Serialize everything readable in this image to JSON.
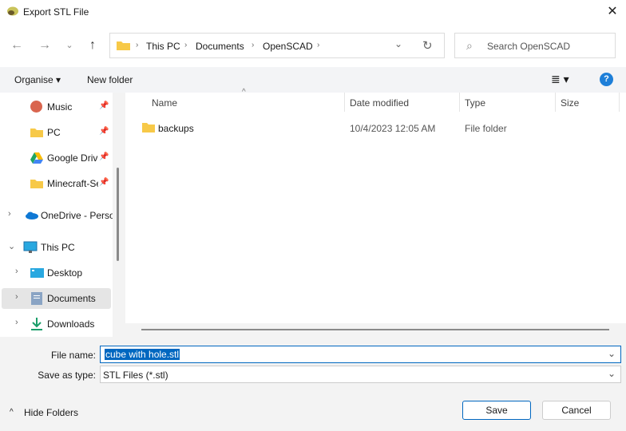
{
  "window": {
    "title": "Export STL File",
    "close": "✕"
  },
  "nav": {
    "back": "←",
    "forward": "→",
    "recent": "⌄",
    "up": "↑"
  },
  "address": {
    "crumbs": [
      "This PC",
      "Documents",
      "OpenSCAD"
    ],
    "sep": "›",
    "dropdown": "⌄",
    "refresh": "↻"
  },
  "search": {
    "placeholder": "Search OpenSCAD",
    "icon": "⌕"
  },
  "toolbar": {
    "organise": "Organise ▾",
    "new_folder": "New folder",
    "view": "≣ ▾",
    "help": "?"
  },
  "sidebar": {
    "items": [
      {
        "label": "Music",
        "pinned": true
      },
      {
        "label": "PC",
        "pinned": true
      },
      {
        "label": "Google Drive",
        "pinned": true
      },
      {
        "label": "Minecraft-Server",
        "pinned": true
      },
      {
        "label": "OneDrive - Personal"
      },
      {
        "label": "This PC"
      },
      {
        "label": "Desktop"
      },
      {
        "label": "Documents",
        "selected": true
      },
      {
        "label": "Downloads"
      }
    ],
    "pin": "📌",
    "collapsed": "›",
    "expanded": "⌄"
  },
  "columns": {
    "name": "Name",
    "date": "Date modified",
    "type": "Type",
    "size": "Size",
    "sort_indicator": "^"
  },
  "files": [
    {
      "name": "backups",
      "date": "10/4/2023 12:05 AM",
      "type": "File folder",
      "size": ""
    }
  ],
  "footer": {
    "file_name_label": "File name:",
    "file_name_value": "cube with hole.stl",
    "type_label": "Save as type:",
    "type_value": "STL Files (*.stl)",
    "hide_folders": "Hide Folders",
    "save": "Save",
    "cancel": "Cancel",
    "dropdown": "⌄"
  }
}
